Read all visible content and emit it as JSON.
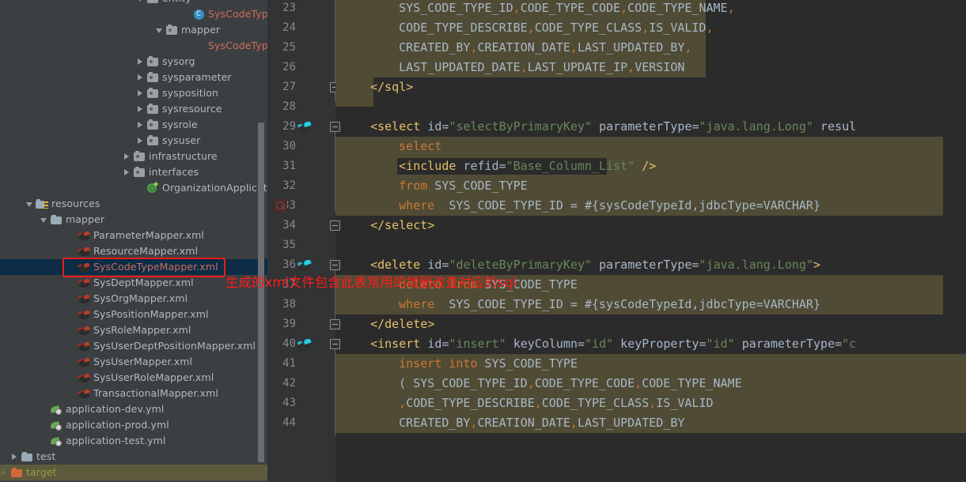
{
  "tree": {
    "panel_name": "project-tree",
    "rows": [
      {
        "id": "entity",
        "label": "entity",
        "indent": 172,
        "arrow": "down",
        "icon": "pkg",
        "color": "grey",
        "cut_top": true
      },
      {
        "id": "SysCodeType",
        "label": "SysCodeType",
        "indent": 230,
        "arrow": "none",
        "icon": "class-c",
        "color": "red"
      },
      {
        "id": "mapper-java",
        "label": "mapper",
        "indent": 196,
        "arrow": "down",
        "icon": "pkg",
        "color": "grey"
      },
      {
        "id": "SysCodeTypeMapper",
        "label": "SysCodeTypeMa",
        "indent": 230,
        "arrow": "none",
        "icon": "mybatis-cy",
        "color": "red"
      },
      {
        "id": "sysorg",
        "label": "sysorg",
        "indent": 172,
        "arrow": "right",
        "icon": "pkg",
        "color": "grey"
      },
      {
        "id": "sysparameter",
        "label": "sysparameter",
        "indent": 172,
        "arrow": "right",
        "icon": "pkg",
        "color": "grey"
      },
      {
        "id": "sysposition",
        "label": "sysposition",
        "indent": 172,
        "arrow": "right",
        "icon": "pkg",
        "color": "grey"
      },
      {
        "id": "sysresource",
        "label": "sysresource",
        "indent": 172,
        "arrow": "right",
        "icon": "pkg",
        "color": "grey"
      },
      {
        "id": "sysrole",
        "label": "sysrole",
        "indent": 172,
        "arrow": "right",
        "icon": "pkg",
        "color": "grey"
      },
      {
        "id": "sysuser",
        "label": "sysuser",
        "indent": 172,
        "arrow": "right",
        "icon": "pkg",
        "color": "grey"
      },
      {
        "id": "infrastructure",
        "label": "infrastructure",
        "indent": 155,
        "arrow": "right",
        "icon": "pkg",
        "color": "grey"
      },
      {
        "id": "interfaces",
        "label": "interfaces",
        "indent": 155,
        "arrow": "right",
        "icon": "pkg",
        "color": "grey"
      },
      {
        "id": "OrganizationApplication",
        "label": "OrganizationApplication",
        "indent": 172,
        "arrow": "none",
        "icon": "spring",
        "color": "grey"
      },
      {
        "id": "resources",
        "label": "resources",
        "indent": 32,
        "arrow": "down",
        "icon": "res",
        "color": "grey"
      },
      {
        "id": "mapper-res",
        "label": "mapper",
        "indent": 50,
        "arrow": "down",
        "icon": "folder",
        "color": "grey"
      },
      {
        "id": "ParameterMapper",
        "label": "ParameterMapper.xml",
        "indent": 85,
        "arrow": "none",
        "icon": "mybatis",
        "color": "grey"
      },
      {
        "id": "ResourceMapper",
        "label": "ResourceMapper.xml",
        "indent": 85,
        "arrow": "none",
        "icon": "mybatis",
        "color": "grey"
      },
      {
        "id": "SysCodeTypeMapper-xml",
        "label": "SysCodeTypeMapper.xml",
        "indent": 85,
        "arrow": "none",
        "icon": "mybatis",
        "color": "red",
        "selected": true
      },
      {
        "id": "SysDeptMapper",
        "label": "SysDeptMapper.xml",
        "indent": 85,
        "arrow": "none",
        "icon": "mybatis",
        "color": "grey"
      },
      {
        "id": "SysOrgMapper",
        "label": "SysOrgMapper.xml",
        "indent": 85,
        "arrow": "none",
        "icon": "mybatis",
        "color": "grey"
      },
      {
        "id": "SysPositionMapper",
        "label": "SysPositionMapper.xml",
        "indent": 85,
        "arrow": "none",
        "icon": "mybatis",
        "color": "grey"
      },
      {
        "id": "SysRoleMapper",
        "label": "SysRoleMapper.xml",
        "indent": 85,
        "arrow": "none",
        "icon": "mybatis",
        "color": "grey"
      },
      {
        "id": "SysUserDeptPositionMapper",
        "label": "SysUserDeptPositionMapper.xml",
        "indent": 85,
        "arrow": "none",
        "icon": "mybatis",
        "color": "grey"
      },
      {
        "id": "SysUserMapper",
        "label": "SysUserMapper.xml",
        "indent": 85,
        "arrow": "none",
        "icon": "mybatis",
        "color": "grey"
      },
      {
        "id": "SysUserRoleMapper",
        "label": "SysUserRoleMapper.xml",
        "indent": 85,
        "arrow": "none",
        "icon": "mybatis",
        "color": "grey"
      },
      {
        "id": "TransactionalMapper",
        "label": "TransactionalMapper.xml",
        "indent": 85,
        "arrow": "none",
        "icon": "mybatis",
        "color": "grey"
      },
      {
        "id": "application-dev",
        "label": "application-dev.yml",
        "indent": 50,
        "arrow": "none",
        "icon": "yml",
        "color": "grey"
      },
      {
        "id": "application-prod",
        "label": "application-prod.yml",
        "indent": 50,
        "arrow": "none",
        "icon": "yml",
        "color": "grey"
      },
      {
        "id": "application-test",
        "label": "application-test.yml",
        "indent": 50,
        "arrow": "none",
        "icon": "yml",
        "color": "grey"
      },
      {
        "id": "test",
        "label": "test",
        "indent": 13,
        "arrow": "right",
        "icon": "folder",
        "color": "grey"
      },
      {
        "id": "target",
        "label": "target",
        "indent": 0,
        "arrow": "right-dim",
        "icon": "folder-orange",
        "color": "olive",
        "target": true
      }
    ]
  },
  "annotation": {
    "text": "生成的xml文件包含此表常用的增删改查对应的sql",
    "color": "#ff1a1a"
  },
  "editor": {
    "file": "SysCodeTypeMapper.xml",
    "first_line_number": 23,
    "lines": [
      {
        "n": 23,
        "gutter_icon": null,
        "indent": 8,
        "tokens": [
          {
            "t": "SYS_CODE_TYPE_ID",
            "c": "plain"
          },
          {
            "t": ",",
            "c": "punct"
          },
          {
            "t": "CODE_TYPE_CODE",
            "c": "plain"
          },
          {
            "t": ",",
            "c": "punct"
          },
          {
            "t": "CODE_TYPE_NAME",
            "c": "plain"
          },
          {
            "t": ",",
            "c": "punct"
          }
        ]
      },
      {
        "n": 24,
        "gutter_icon": null,
        "indent": 8,
        "tokens": [
          {
            "t": "CODE_TYPE_DESCRIBE",
            "c": "plain"
          },
          {
            "t": ",",
            "c": "punct"
          },
          {
            "t": "CODE_TYPE_CLASS",
            "c": "plain"
          },
          {
            "t": ",",
            "c": "punct"
          },
          {
            "t": "IS_VALID",
            "c": "plain"
          },
          {
            "t": ",",
            "c": "punct"
          }
        ]
      },
      {
        "n": 25,
        "gutter_icon": null,
        "indent": 8,
        "tokens": [
          {
            "t": "CREATED_BY",
            "c": "plain"
          },
          {
            "t": ",",
            "c": "punct"
          },
          {
            "t": "CREATION_DATE",
            "c": "plain"
          },
          {
            "t": ",",
            "c": "punct"
          },
          {
            "t": "LAST_UPDATED_BY",
            "c": "plain"
          },
          {
            "t": ",",
            "c": "punct"
          }
        ]
      },
      {
        "n": 26,
        "gutter_icon": null,
        "indent": 8,
        "tokens": [
          {
            "t": "LAST_UPDATED_DATE",
            "c": "plain"
          },
          {
            "t": ",",
            "c": "punct"
          },
          {
            "t": "LAST_UPDATE_IP",
            "c": "plain"
          },
          {
            "t": ",",
            "c": "punct"
          },
          {
            "t": "VERSION",
            "c": "plain"
          }
        ]
      },
      {
        "n": 27,
        "gutter_icon": null,
        "indent": 4,
        "tokens": [
          {
            "t": "</sql>",
            "c": "tag"
          }
        ]
      },
      {
        "n": 28,
        "gutter_icon": null,
        "indent": 0,
        "tokens": []
      },
      {
        "n": 29,
        "gutter_icon": "mybatis",
        "indent": 4,
        "tokens": [
          {
            "t": "<select ",
            "c": "tag"
          },
          {
            "t": "id=",
            "c": "attr"
          },
          {
            "t": "\"selectByPrimaryKey\"",
            "c": "val"
          },
          {
            "t": " parameterType=",
            "c": "attr"
          },
          {
            "t": "\"java.lang.Long\"",
            "c": "val"
          },
          {
            "t": " resul",
            "c": "attr"
          }
        ]
      },
      {
        "n": 30,
        "gutter_icon": null,
        "indent": 8,
        "tokens": [
          {
            "t": "select",
            "c": "kw"
          }
        ]
      },
      {
        "n": 31,
        "gutter_icon": null,
        "indent": 8,
        "tokens": [
          {
            "t": "<include ",
            "c": "tag"
          },
          {
            "t": "refid=",
            "c": "attr"
          },
          {
            "t": "\"Base_Column_List\"",
            "c": "val"
          },
          {
            "t": " ",
            "c": "attr"
          },
          {
            "t": "/>",
            "c": "tag"
          }
        ]
      },
      {
        "n": 32,
        "gutter_icon": null,
        "indent": 8,
        "tokens": [
          {
            "t": "from",
            "c": "kw"
          },
          {
            "t": " SYS_CODE_TYPE",
            "c": "plain"
          }
        ]
      },
      {
        "n": 33,
        "gutter_icon": "usage",
        "indent": 8,
        "tokens": [
          {
            "t": "where",
            "c": "kw"
          },
          {
            "t": "  SYS_CODE_TYPE_ID = #{sysCodeTypeId,jdbcType=VARCHAR}",
            "c": "plain"
          }
        ]
      },
      {
        "n": 34,
        "gutter_icon": null,
        "indent": 4,
        "tokens": [
          {
            "t": "</select>",
            "c": "tag"
          }
        ]
      },
      {
        "n": 35,
        "gutter_icon": null,
        "indent": 0,
        "tokens": []
      },
      {
        "n": 36,
        "gutter_icon": "mybatis",
        "indent": 4,
        "tokens": [
          {
            "t": "<delete ",
            "c": "tag"
          },
          {
            "t": "id=",
            "c": "attr"
          },
          {
            "t": "\"deleteByPrimaryKey\"",
            "c": "val"
          },
          {
            "t": " parameterType=",
            "c": "attr"
          },
          {
            "t": "\"java.lang.Long\"",
            "c": "val"
          },
          {
            "t": ">",
            "c": "tag"
          }
        ]
      },
      {
        "n": 37,
        "gutter_icon": null,
        "indent": 8,
        "tokens": [
          {
            "t": "delete from",
            "c": "kw"
          },
          {
            "t": " SYS_CODE_TYPE",
            "c": "plain"
          }
        ]
      },
      {
        "n": 38,
        "gutter_icon": null,
        "indent": 8,
        "tokens": [
          {
            "t": "where",
            "c": "kw"
          },
          {
            "t": "  SYS_CODE_TYPE_ID = #{sysCodeTypeId,jdbcType=VARCHAR}",
            "c": "plain"
          }
        ]
      },
      {
        "n": 39,
        "gutter_icon": null,
        "indent": 4,
        "tokens": [
          {
            "t": "</delete>",
            "c": "tag"
          }
        ]
      },
      {
        "n": 40,
        "gutter_icon": "mybatis",
        "indent": 4,
        "tokens": [
          {
            "t": "<insert ",
            "c": "tag"
          },
          {
            "t": "id=",
            "c": "attr"
          },
          {
            "t": "\"insert\"",
            "c": "val"
          },
          {
            "t": " keyColumn=",
            "c": "attr"
          },
          {
            "t": "\"id\"",
            "c": "val"
          },
          {
            "t": " keyProperty=",
            "c": "attr"
          },
          {
            "t": "\"id\"",
            "c": "val"
          },
          {
            "t": " parameterType=",
            "c": "attr"
          },
          {
            "t": "\"c",
            "c": "val"
          }
        ]
      },
      {
        "n": 41,
        "gutter_icon": null,
        "indent": 8,
        "tokens": [
          {
            "t": "insert into",
            "c": "kw"
          },
          {
            "t": " SYS_CODE_TYPE",
            "c": "plain"
          }
        ]
      },
      {
        "n": 42,
        "gutter_icon": null,
        "indent": 8,
        "tokens": [
          {
            "t": "( SYS_CODE_TYPE_ID",
            "c": "plain"
          },
          {
            "t": ",",
            "c": "punct"
          },
          {
            "t": "CODE_TYPE_CODE",
            "c": "plain"
          },
          {
            "t": ",",
            "c": "punct"
          },
          {
            "t": "CODE_TYPE_NAME",
            "c": "plain"
          }
        ]
      },
      {
        "n": 43,
        "gutter_icon": null,
        "indent": 8,
        "tokens": [
          {
            "t": ",",
            "c": "punct"
          },
          {
            "t": "CODE_TYPE_DESCRIBE",
            "c": "plain"
          },
          {
            "t": ",",
            "c": "punct"
          },
          {
            "t": "CODE_TYPE_CLASS",
            "c": "plain"
          },
          {
            "t": ",",
            "c": "punct"
          },
          {
            "t": "IS_VALID",
            "c": "plain"
          }
        ]
      },
      {
        "n": 44,
        "gutter_icon": null,
        "indent": 8,
        "tokens": [
          {
            "t": "CREATED_BY",
            "c": "plain"
          },
          {
            "t": ",",
            "c": "punct"
          },
          {
            "t": "CREATION_DATE",
            "c": "plain"
          },
          {
            "t": ",",
            "c": "punct"
          },
          {
            "t": "LAST_UPDATED_BY",
            "c": "plain"
          }
        ]
      }
    ]
  }
}
